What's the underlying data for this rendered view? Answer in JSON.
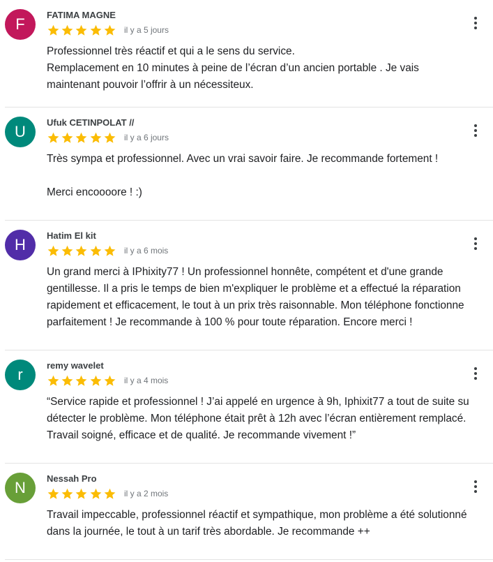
{
  "colors": {
    "star": "#fbbc04",
    "divider": "#e3e3e3",
    "author": "#3c4043",
    "date": "#70757a",
    "text": "#202124"
  },
  "icons": {
    "star": "star-icon",
    "menu": "more-vert-icon"
  },
  "reviews": [
    {
      "initial": "F",
      "avatar_color": "#c2185b",
      "author": "FATIMA MAGNE",
      "rating": 5,
      "date": "il y a 5 jours",
      "lines": [
        "Professionnel très réactif et qui a le sens du service.",
        "Remplacement en 10 minutes à peine de l’écran d’un ancien portable . Je vais",
        "maintenant pouvoir l’offrir à un nécessiteux."
      ]
    },
    {
      "initial": "U",
      "avatar_color": "#00897b",
      "author": "Ufuk CETINPOLAT //",
      "rating": 5,
      "date": "il y a 6 jours",
      "lines": [
        "Très sympa et professionnel. Avec un vrai savoir faire. Je recommande fortement !",
        "",
        "Merci encoooore ! :)"
      ]
    },
    {
      "initial": "H",
      "avatar_color": "#512da8",
      "author": "Hatim El kit",
      "rating": 5,
      "date": "il y a 6 mois",
      "lines": [
        "Un grand merci à IPhixity77 ! Un professionnel honnête, compétent et d'une grande",
        "gentillesse. Il a pris le temps de bien m'expliquer le problème et a effectué la réparation",
        "rapidement et efficacement, le tout à un prix très raisonnable. Mon téléphone fonctionne",
        "parfaitement ! Je recommande à 100 % pour toute réparation. Encore merci !"
      ]
    },
    {
      "initial": "r",
      "avatar_color": "#00897b",
      "author": "remy wavelet",
      "rating": 5,
      "date": "il y a 4 mois",
      "lines": [
        "“Service rapide et professionnel ! J’ai appelé en urgence à 9h, Iphixit77 a tout de suite su",
        "détecter le problème. Mon téléphone était prêt à 12h avec l’écran entièrement remplacé.",
        "Travail soigné, efficace et de qualité. Je recommande vivement !”"
      ]
    },
    {
      "initial": "N",
      "avatar_color": "#689f38",
      "author": "Nessah Pro",
      "rating": 5,
      "date": "il y a 2 mois",
      "lines": [
        "Travail impeccable, professionnel réactif et sympathique, mon problème a été solutionné",
        "dans la journée, le tout à un tarif très abordable. Je recommande ++"
      ]
    }
  ]
}
